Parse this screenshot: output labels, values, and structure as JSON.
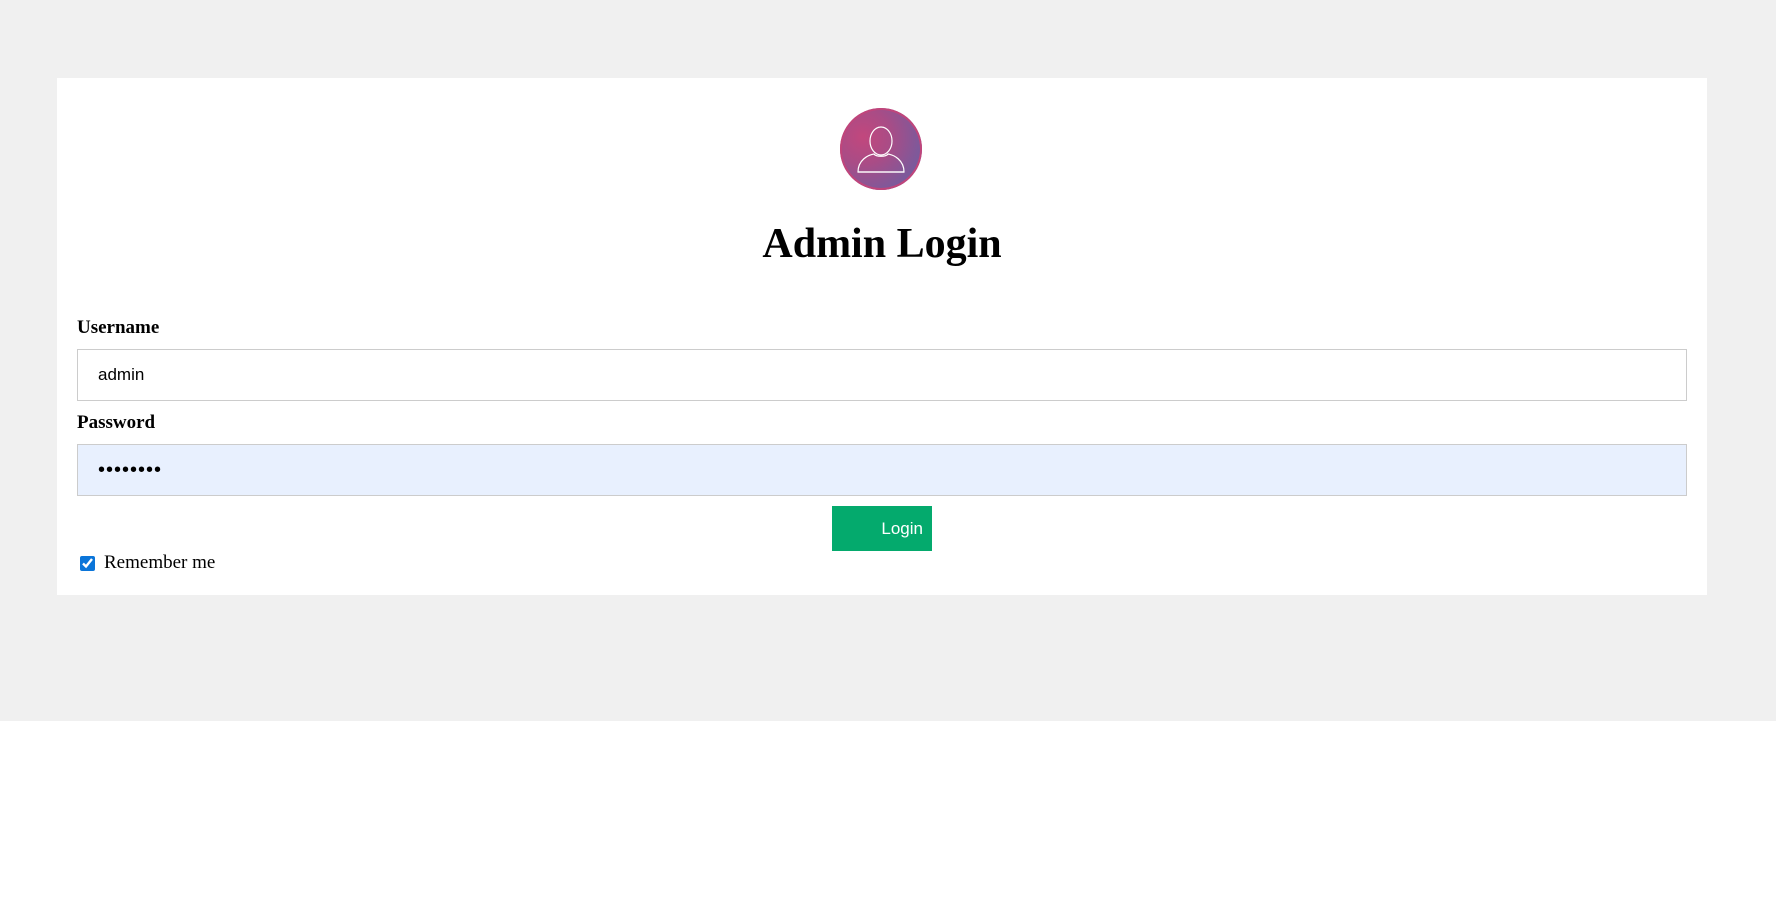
{
  "login": {
    "title": "Admin Login",
    "username_label": "Username",
    "username_value": "admin",
    "password_label": "Password",
    "password_value": "password",
    "login_button_label": "Login",
    "remember_label": "Remember me",
    "remember_checked": true
  },
  "icons": {
    "avatar": "user-avatar-icon"
  },
  "colors": {
    "page_background": "#f0f0f0",
    "card_background": "#ffffff",
    "login_button": "#04aa6d",
    "password_autofill_bg": "#e8f0fe",
    "avatar_gradient_start": "#c2477d",
    "avatar_gradient_end": "#6e5ea2"
  }
}
